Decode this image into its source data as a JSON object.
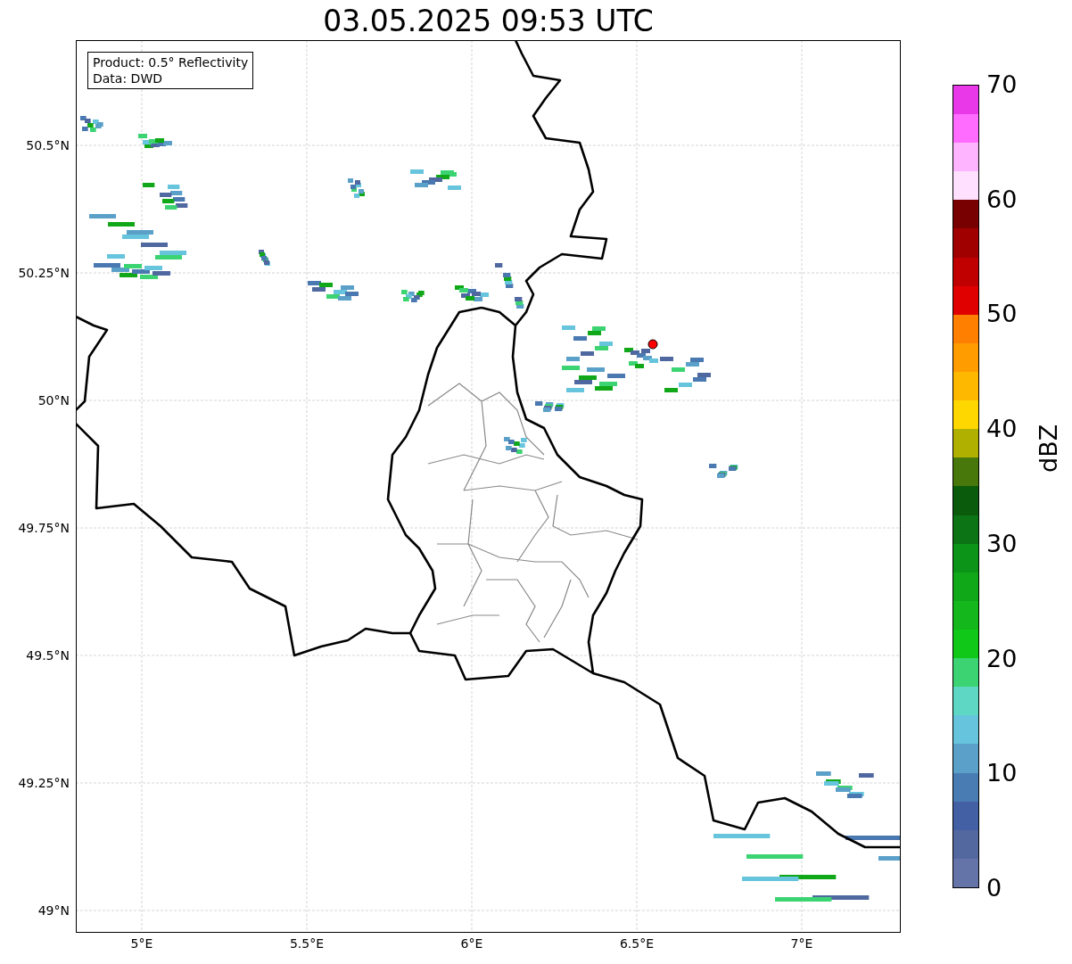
{
  "title": "03.05.2025 09:53 UTC",
  "info_box": [
    "Product: 0.5° Reflectivity",
    "Data: DWD"
  ],
  "x_ticks": [
    "5°E",
    "5.5°E",
    "6°E",
    "6.5°E",
    "7°E"
  ],
  "y_ticks": [
    "50.5°N",
    "50.25°N",
    "50°N",
    "49.75°N",
    "49.5°N",
    "49.25°N",
    "49°N"
  ],
  "colorbar": {
    "label": "dBZ",
    "ticks": [
      "70",
      "60",
      "50",
      "40",
      "30",
      "20",
      "10",
      "0"
    ],
    "bins": [
      {
        "color": "#6474a8"
      },
      {
        "color": "#5468a0"
      },
      {
        "color": "#4460a4"
      },
      {
        "color": "#4a7cb4"
      },
      {
        "color": "#5aa0c8"
      },
      {
        "color": "#66c4dc"
      },
      {
        "color": "#5ed8c4"
      },
      {
        "color": "#3cd472"
      },
      {
        "color": "#10c818"
      },
      {
        "color": "#14b81c"
      },
      {
        "color": "#10a818"
      },
      {
        "color": "#0c9418"
      },
      {
        "color": "#0c7414"
      },
      {
        "color": "#0a5c0c"
      },
      {
        "color": "#48780c"
      },
      {
        "color": "#b0b000"
      },
      {
        "color": "#ffd700"
      },
      {
        "color": "#ffb800"
      },
      {
        "color": "#ff9c00"
      },
      {
        "color": "#ff7f00"
      },
      {
        "color": "#e00000"
      },
      {
        "color": "#c00000"
      },
      {
        "color": "#a00000"
      },
      {
        "color": "#780000"
      },
      {
        "color": "#ffe0ff"
      },
      {
        "color": "#ffb4ff"
      },
      {
        "color": "#ff6cff"
      },
      {
        "color": "#e838e8"
      }
    ]
  }
}
